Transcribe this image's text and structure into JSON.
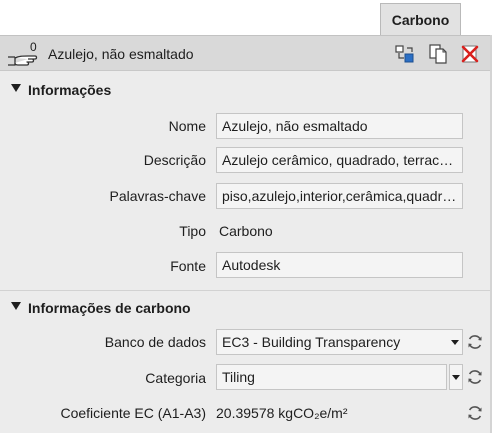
{
  "tabs": [
    {
      "label": "Carbono",
      "active": true
    }
  ],
  "header": {
    "title": "Azulejo, não esmaltado",
    "usage_count": "0"
  },
  "sections": {
    "info": {
      "title": "Informações",
      "name_label": "Nome",
      "name_value": "Azulejo, não esmaltado",
      "description_label": "Descrição",
      "description_value": "Azulejo cerâmico, quadrado, terracota",
      "keywords_label": "Palavras-chave",
      "keywords_value": "piso,azulejo,interior,cerâmica,quadrado",
      "type_label": "Tipo",
      "type_value": "Carbono",
      "source_label": "Fonte",
      "source_value": "Autodesk"
    },
    "carbon": {
      "title": "Informações de carbono",
      "database_label": "Banco de dados",
      "database_value": "EC3 - Building Transparency",
      "category_label": "Categoria",
      "category_value": "Tiling",
      "coefficient_label": "Coeficiente EC (A1-A3)",
      "coefficient_value": "20.39578 kgCO₂e/m²"
    }
  },
  "colors": {
    "close_red": "#d9211e",
    "accent_blue": "#2b6fc4",
    "panel_bg": "#ececec"
  },
  "icons": [
    "hand-icon",
    "duplicate-asset-icon",
    "copy-icon",
    "delete-icon",
    "refresh-icon",
    "triangle-down-icon"
  ]
}
